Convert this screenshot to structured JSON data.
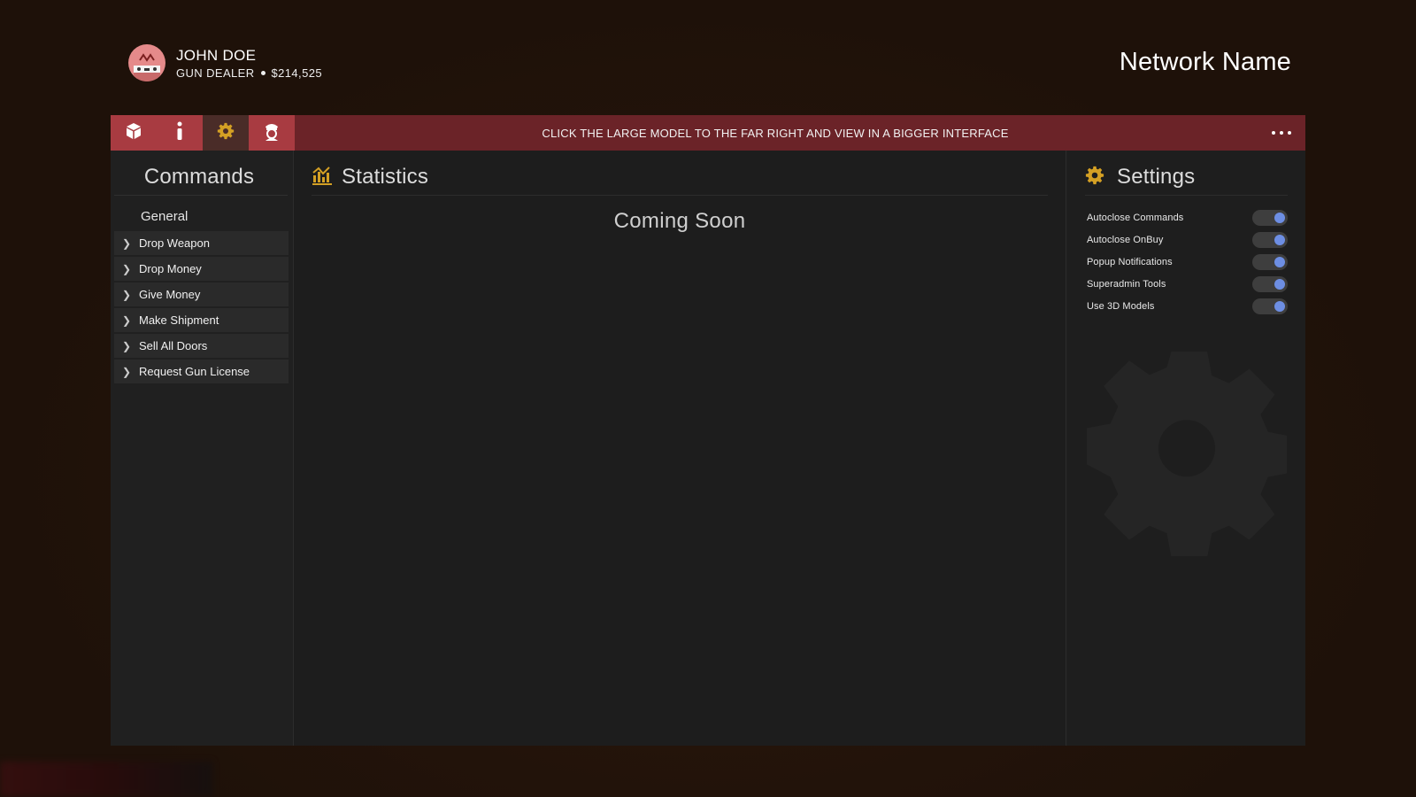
{
  "profile": {
    "name": "JOHN DOE",
    "job": "GUN DEALER",
    "money": "$214,525"
  },
  "network_name": "Network Name",
  "topbar": {
    "tabs": [
      {
        "icon": "cube-icon",
        "active": false
      },
      {
        "icon": "info-icon",
        "active": false
      },
      {
        "icon": "gear-icon",
        "active": true
      },
      {
        "icon": "police-officer-icon",
        "active": false
      }
    ],
    "banner": "CLICK THE LARGE MODEL TO THE FAR RIGHT AND VIEW IN A BIGGER INTERFACE",
    "more_icon": "ellipsis-icon"
  },
  "commands": {
    "title": "Commands",
    "group": "General",
    "items": [
      "Drop Weapon",
      "Drop Money",
      "Give Money",
      "Make Shipment",
      "Sell All Doors",
      "Request Gun License"
    ]
  },
  "statistics": {
    "title": "Statistics",
    "icon": "bar-chart-icon",
    "message": "Coming Soon"
  },
  "settings": {
    "title": "Settings",
    "icon": "gear-icon",
    "items": [
      {
        "label": "Autoclose Commands",
        "enabled": true
      },
      {
        "label": "Autoclose OnBuy",
        "enabled": true
      },
      {
        "label": "Popup Notifications",
        "enabled": true
      },
      {
        "label": "Superadmin Tools",
        "enabled": true
      },
      {
        "label": "Use 3D Models",
        "enabled": true
      }
    ]
  },
  "colors": {
    "accent": "#d4a024",
    "topbar": "#6b2328",
    "tab": "#a83b41",
    "toggle_on": "#6d8ee3"
  }
}
